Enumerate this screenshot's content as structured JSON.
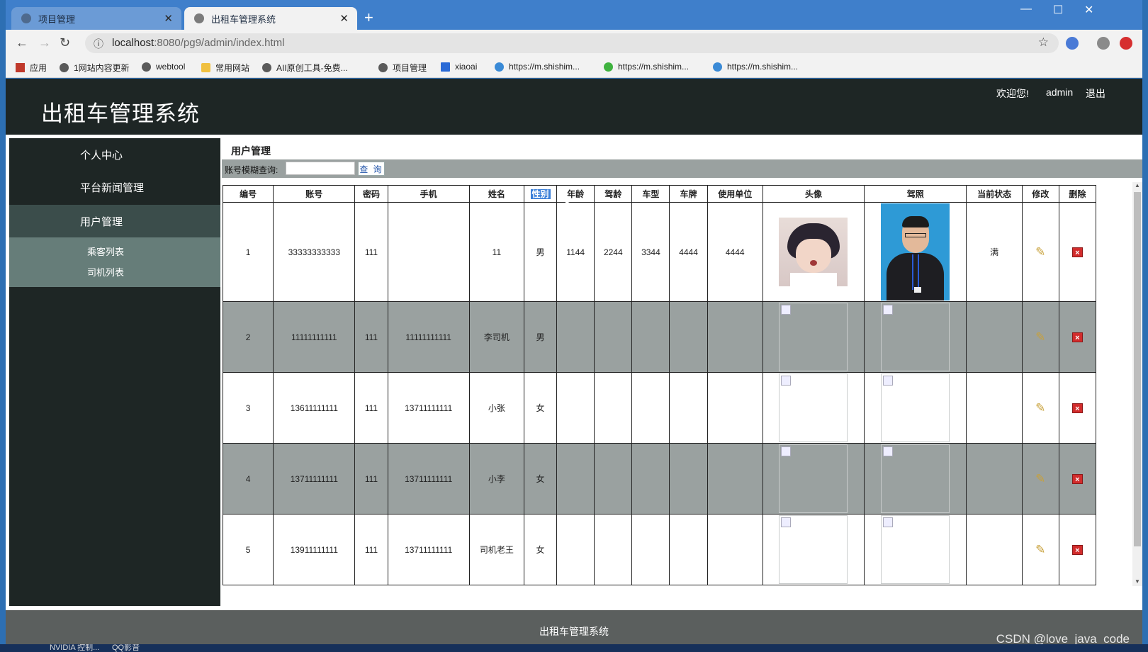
{
  "browser": {
    "tabs": [
      {
        "title": "项目管理",
        "active": false
      },
      {
        "title": "出租车管理系统",
        "active": true
      }
    ],
    "url_host": "localhost",
    "url_rest": ":8080/pg9/admin/index.html",
    "bookmarks": [
      {
        "label": "应用",
        "icon": "apps-grid-icon"
      },
      {
        "label": "1网站内容更新",
        "icon": "globe-icon"
      },
      {
        "label": "webtool",
        "icon": "globe-icon"
      },
      {
        "label": "常用网站",
        "icon": "folder-icon"
      },
      {
        "label": "AII原创工具-免费...",
        "icon": "globe-icon"
      },
      {
        "label": "项目管理",
        "icon": "globe-icon"
      },
      {
        "label": "xiaoai",
        "icon": "p-logo-icon"
      },
      {
        "label": "https://m.shishim...",
        "icon": "site-icon"
      },
      {
        "label": "https://m.shishim...",
        "icon": "wechat-icon"
      },
      {
        "label": "https://m.shishim...",
        "icon": "site-icon"
      }
    ]
  },
  "header": {
    "title": "出租车管理系统",
    "welcome": "欢迎您!",
    "user": "admin",
    "logout": "退出"
  },
  "sidebar": {
    "items": [
      {
        "label": "个人中心"
      },
      {
        "label": "平台新闻管理"
      },
      {
        "label": "用户管理"
      }
    ],
    "subitems": [
      {
        "label": "乘客列表"
      },
      {
        "label": "司机列表"
      }
    ]
  },
  "main": {
    "crumb": "用户管理",
    "search_label": "账号模糊查询:",
    "search_value": "",
    "search_button": "查 询",
    "columns": [
      "编号",
      "账号",
      "密码",
      "手机",
      "姓名",
      "性别",
      "年龄",
      "驾龄",
      "车型",
      "车牌",
      "使用单位",
      "头像",
      "驾照",
      "当前状态",
      "修改",
      "删除"
    ],
    "rows": [
      {
        "id": "1",
        "account": "33333333333",
        "password": "111",
        "phone": "",
        "name": "11",
        "gender": "男",
        "age": "1144",
        "driving_years": "2244",
        "car_model": "3344",
        "plate": "4444",
        "unit": "4444",
        "status": "满"
      },
      {
        "id": "2",
        "account": "11111111111",
        "password": "111",
        "phone": "11111111111",
        "name": "李司机",
        "gender": "男",
        "age": "",
        "driving_years": "",
        "car_model": "",
        "plate": "",
        "unit": "",
        "status": ""
      },
      {
        "id": "3",
        "account": "13611111111",
        "password": "111",
        "phone": "13711111111",
        "name": "小张",
        "gender": "女",
        "age": "",
        "driving_years": "",
        "car_model": "",
        "plate": "",
        "unit": "",
        "status": ""
      },
      {
        "id": "4",
        "account": "13711111111",
        "password": "111",
        "phone": "13711111111",
        "name": "小李",
        "gender": "女",
        "age": "",
        "driving_years": "",
        "car_model": "",
        "plate": "",
        "unit": "",
        "status": ""
      },
      {
        "id": "5",
        "account": "13911111111",
        "password": "111",
        "phone": "13711111111",
        "name": "司机老王",
        "gender": "女",
        "age": "",
        "driving_years": "",
        "car_model": "",
        "plate": "",
        "unit": "",
        "status": ""
      }
    ]
  },
  "footer": {
    "text": "出租车管理系统"
  },
  "watermark": "CSDN @love_java_code",
  "taskbar": [
    "NVIDIA 控制...",
    "QQ影音"
  ]
}
